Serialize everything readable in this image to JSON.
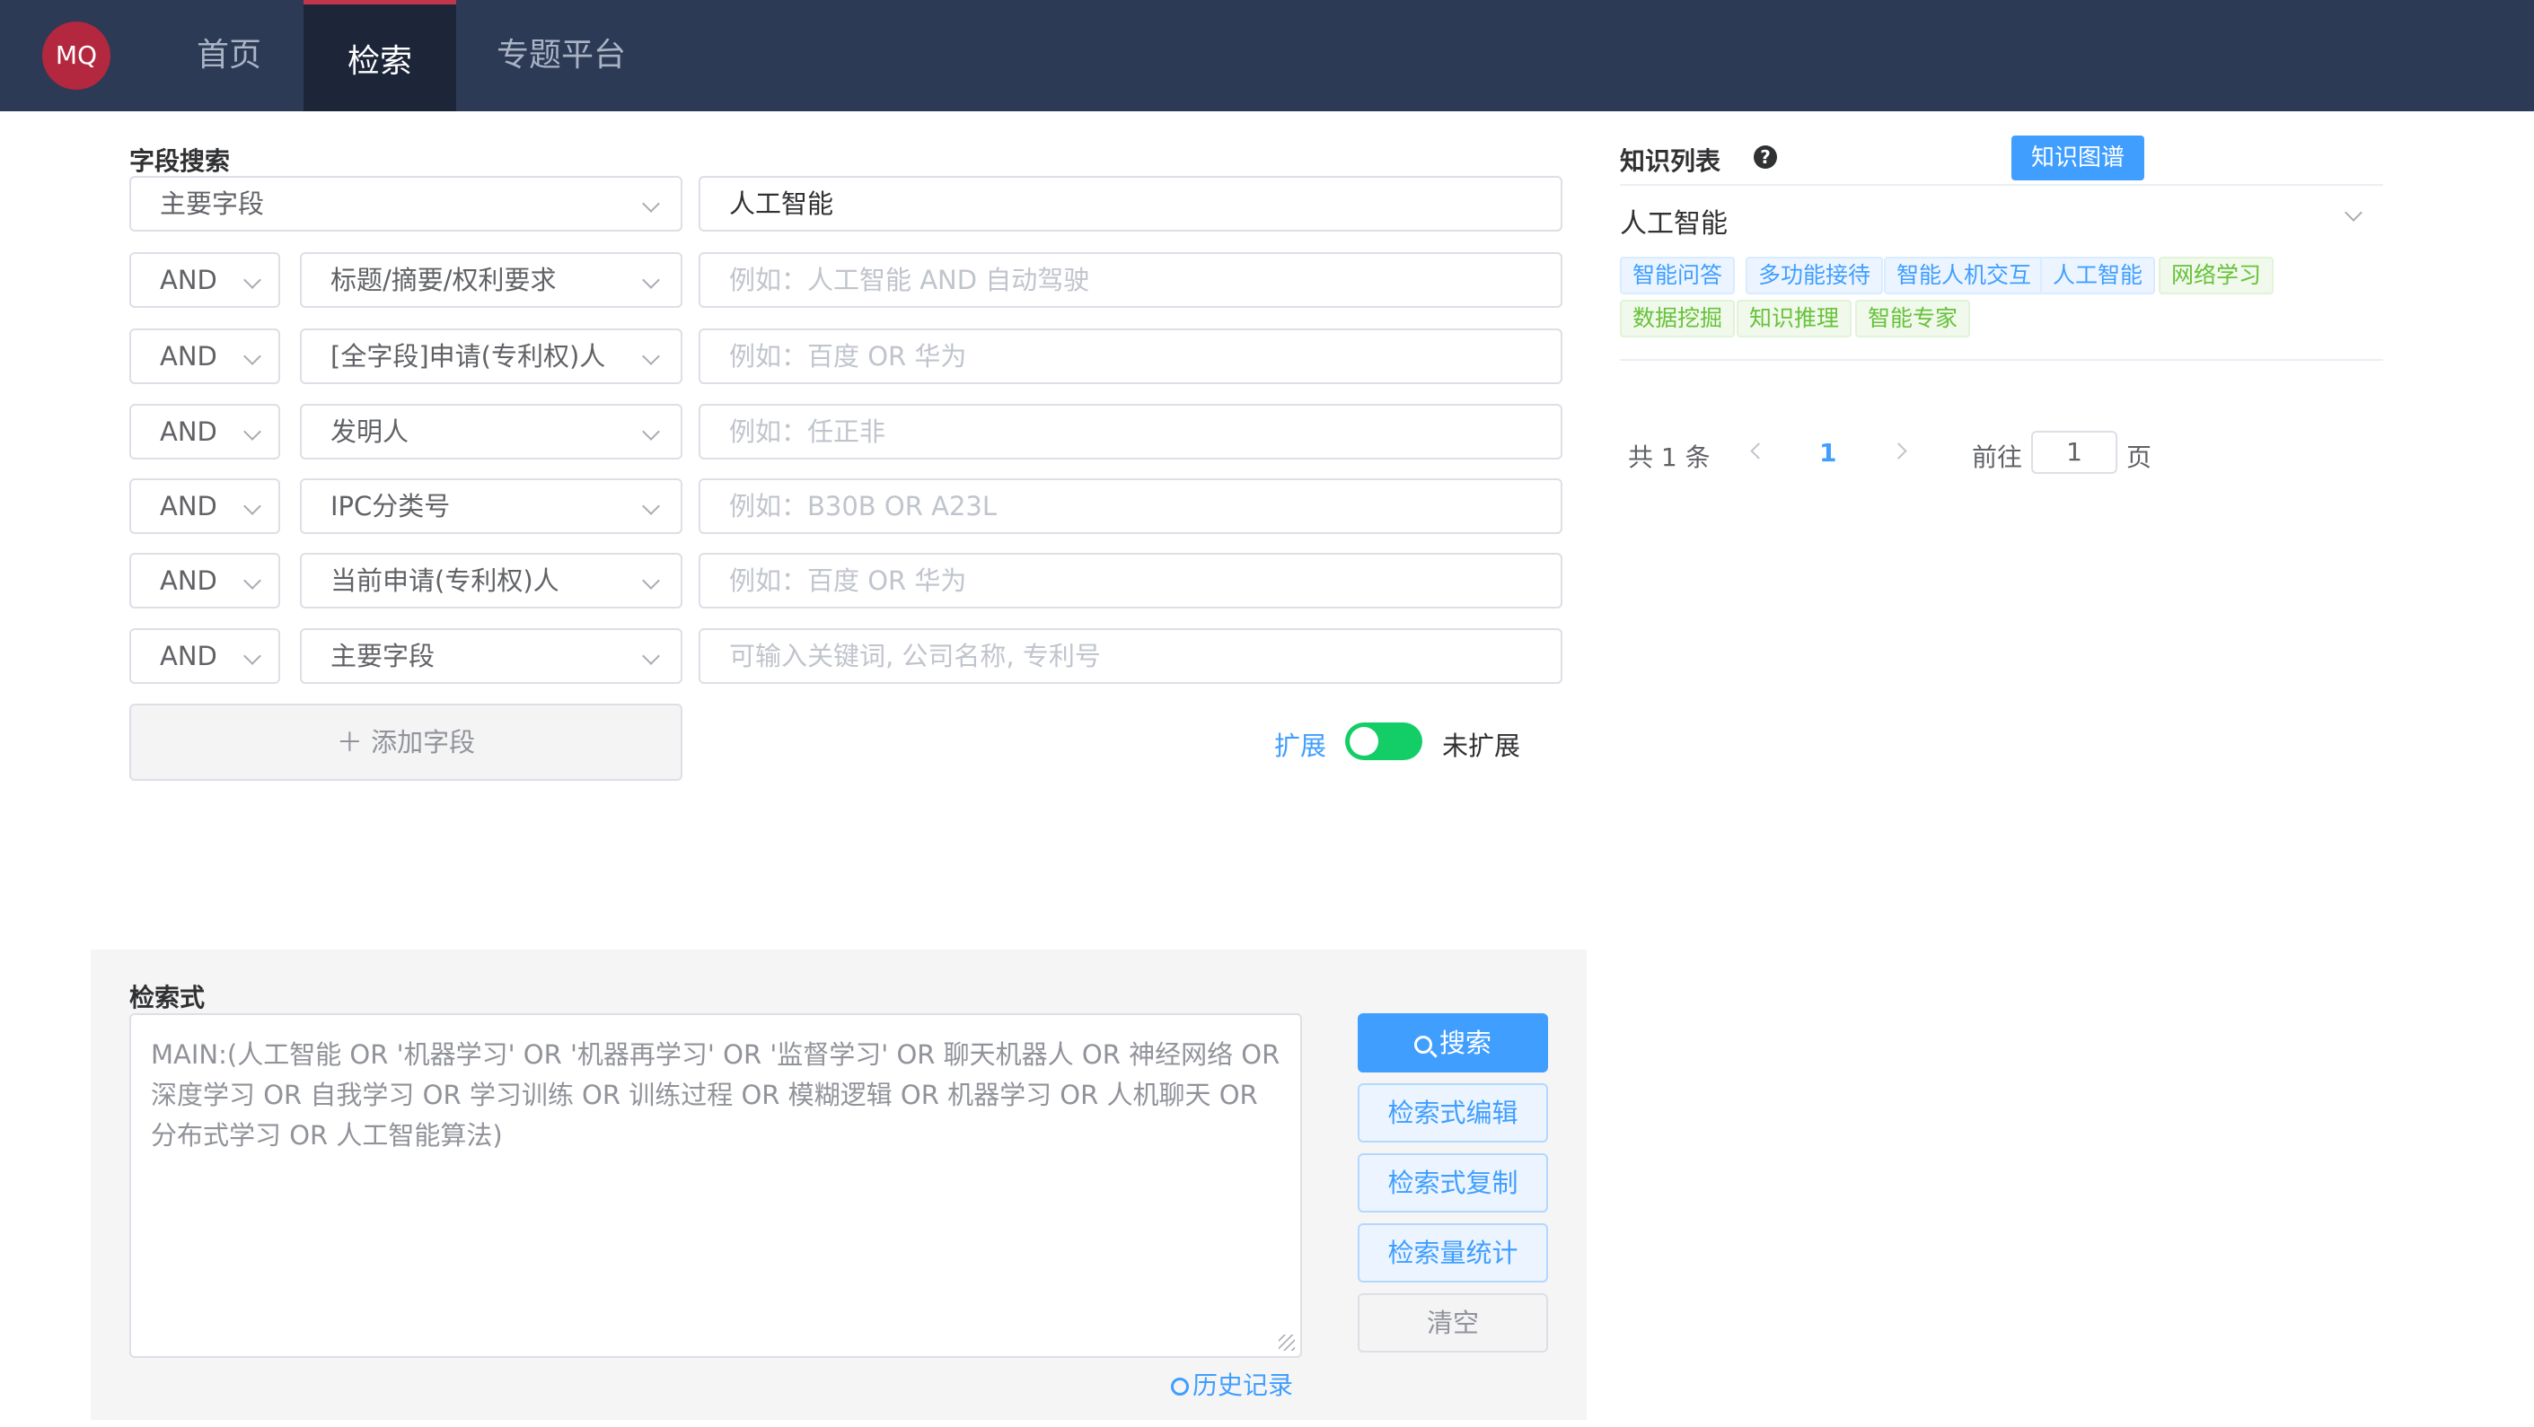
{
  "nav": {
    "logo": "MQ",
    "tabs": [
      "首页",
      "检索",
      "专题平台"
    ],
    "active_tab": "检索"
  },
  "field_search": {
    "title": "字段搜索",
    "first_row": {
      "field": "主要字段",
      "value": "人工智能"
    },
    "rows": [
      {
        "op": "AND",
        "field": "标题/摘要/权利要求",
        "placeholder": "例如：人工智能 AND 自动驾驶"
      },
      {
        "op": "AND",
        "field": "[全字段]申请(专利权)人",
        "placeholder": "例如：百度 OR 华为"
      },
      {
        "op": "AND",
        "field": "发明人",
        "placeholder": "例如：任正非"
      },
      {
        "op": "AND",
        "field": "IPC分类号",
        "placeholder": "例如：B30B OR A23L"
      },
      {
        "op": "AND",
        "field": "当前申请(专利权)人",
        "placeholder": "例如：百度 OR 华为"
      },
      {
        "op": "AND",
        "field": "主要字段",
        "placeholder": "可输入关键词, 公司名称, 专利号"
      }
    ],
    "add_field": "＋ 添加字段",
    "expand_on_label": "扩展",
    "expand_off_label": "未扩展"
  },
  "query": {
    "title": "检索式",
    "text": "MAIN:(人工智能 OR '机器学习' OR '机器再学习' OR '监督学习' OR 聊天机器人 OR 神经网络 OR 深度学习 OR 自我学习 OR 学习训练 OR 训练过程 OR 模糊逻辑 OR 机器学习 OR 人机聊天 OR 分布式学习 OR 人工智能算法)",
    "history": "历史记录",
    "buttons": {
      "search": "搜索",
      "edit": "检索式编辑",
      "copy": "检索式复制",
      "stats": "检索量统计",
      "clear": "清空"
    }
  },
  "knowledge": {
    "title": "知识列表",
    "graph_button": "知识图谱",
    "topic": "人工智能",
    "tags": [
      {
        "text": "智能问答",
        "color": "blue"
      },
      {
        "text": "多功能接待",
        "color": "blue"
      },
      {
        "text": "智能人机交互",
        "color": "blue"
      },
      {
        "text": "人工智能",
        "color": "blue"
      },
      {
        "text": "网络学习",
        "color": "green"
      },
      {
        "text": "数据挖掘",
        "color": "green"
      },
      {
        "text": "知识推理",
        "color": "green"
      },
      {
        "text": "智能专家",
        "color": "green"
      }
    ],
    "pagination": {
      "total": "共 1 条",
      "current_page": "1",
      "goto_label": "前往",
      "goto_value": "1",
      "page_unit": "页"
    }
  },
  "colors": {
    "nav_bg": "#2c3a55",
    "accent": "#409eff",
    "switch_on": "#13ce66",
    "logo_bg": "#b3283e"
  }
}
